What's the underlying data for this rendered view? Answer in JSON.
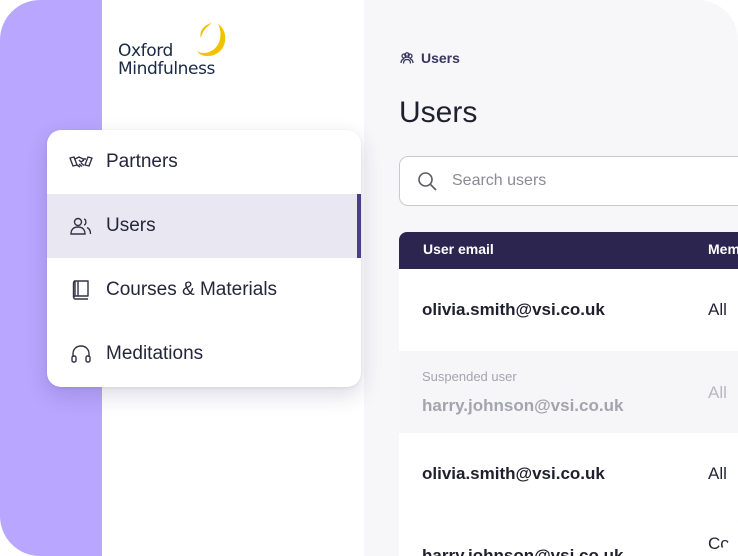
{
  "app": {
    "logo_line1": "Oxford",
    "logo_line2": "Mindfulness"
  },
  "colors": {
    "accent_purple": "#b8a6ff",
    "table_header": "#2b2550",
    "active_indicator": "#4a3f85",
    "logo_mark": "#f2c200"
  },
  "sidebar": {
    "items": [
      {
        "label": "Partners",
        "icon": "handshake-icon",
        "active": false
      },
      {
        "label": "Users",
        "icon": "users-icon",
        "active": true
      },
      {
        "label": "Courses & Materials",
        "icon": "book-icon",
        "active": false
      },
      {
        "label": "Meditations",
        "icon": "headphones-icon",
        "active": false
      }
    ]
  },
  "breadcrumb": {
    "icon": "users-icon",
    "label": "Users"
  },
  "page": {
    "title": "Users"
  },
  "search": {
    "placeholder": "Search users",
    "value": ""
  },
  "table": {
    "columns": [
      "User email",
      "Mem"
    ],
    "rows": [
      {
        "note": "",
        "email": "olivia.smith@vsi.co.uk",
        "member": "All",
        "suspended": false
      },
      {
        "note": "Suspended user",
        "email": "harry.johnson@vsi.co.uk",
        "member": "All",
        "suspended": true
      },
      {
        "note": "",
        "email": "olivia.smith@vsi.co.uk",
        "member": "All",
        "suspended": false
      },
      {
        "note": "",
        "email": "harry.johnson@vsi.co.uk",
        "member": "Co",
        "suspended": false
      }
    ]
  }
}
